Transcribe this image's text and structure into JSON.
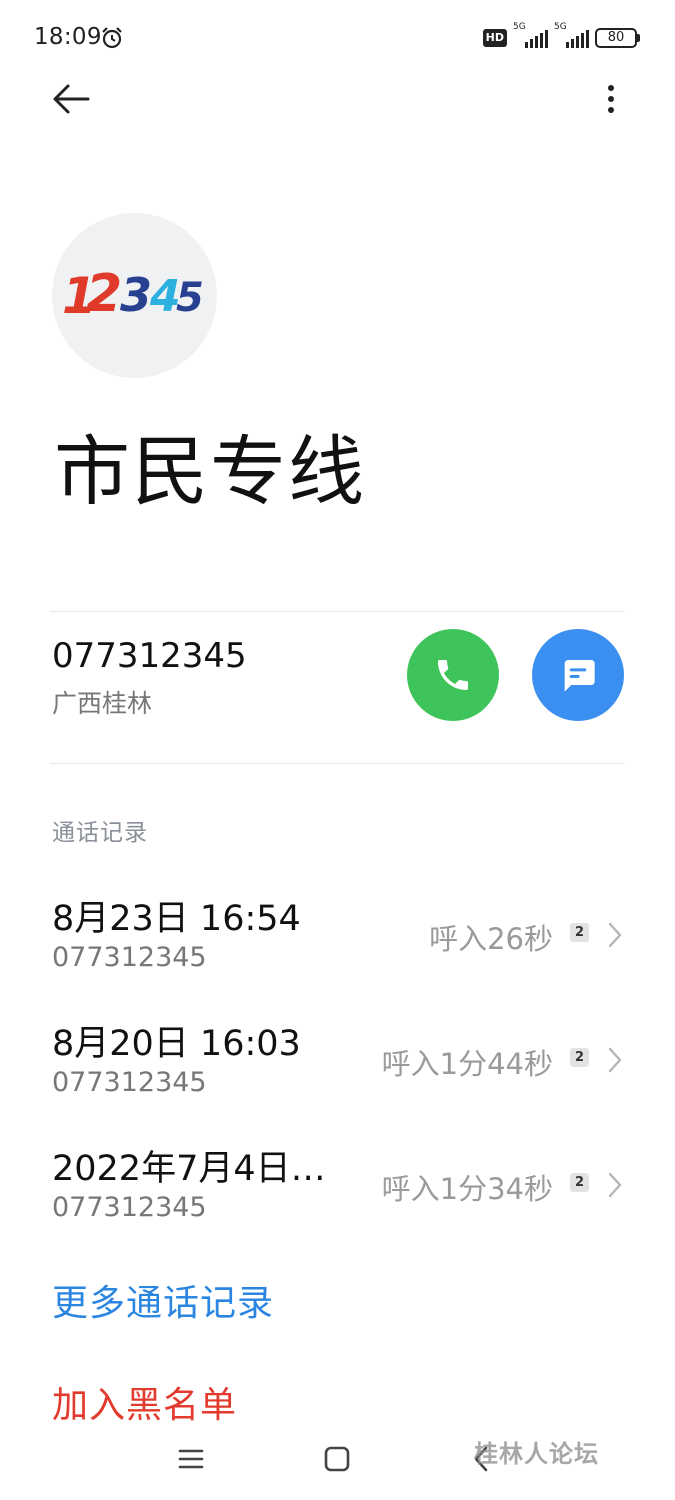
{
  "status_bar": {
    "time": "18:09",
    "hd": "HD",
    "network_1": "5G",
    "network_2": "5G",
    "battery": "80"
  },
  "contact": {
    "name": "市民专线",
    "phone": "077312345",
    "region": "广西桂林",
    "avatar_icon": "12345-logo"
  },
  "call_log": {
    "title": "通话记录",
    "entries": [
      {
        "date": "8月23日 16:54",
        "number": "077312345",
        "detail": "呼入26秒",
        "sim": "2"
      },
      {
        "date": "8月20日 16:03",
        "number": "077312345",
        "detail": "呼入1分44秒",
        "sim": "2"
      },
      {
        "date": "2022年7月4日…",
        "number": "077312345",
        "detail": "呼入1分34秒",
        "sim": "2"
      }
    ]
  },
  "actions": {
    "more_logs": "更多通话记录",
    "block": "加入黑名单"
  },
  "watermark": "桂林人论坛",
  "colors": {
    "call_button": "#3fc45c",
    "message_button": "#3a8ff0",
    "link_blue": "#2a86e0",
    "danger_red": "#e33a2e"
  }
}
